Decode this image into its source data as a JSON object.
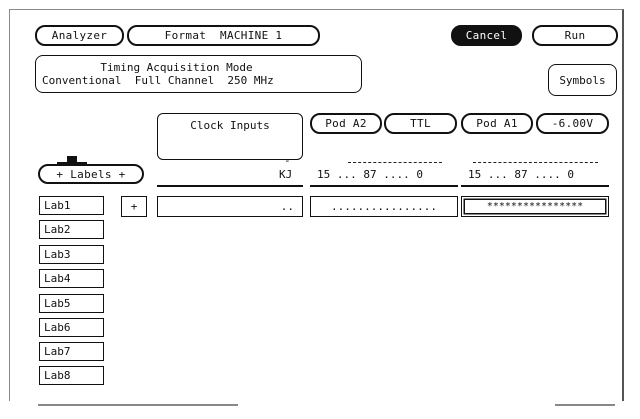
{
  "topbar": {
    "analyzer_label": "Analyzer",
    "format_label": "Format  MACHINE 1",
    "cancel_label": "Cancel",
    "run_label": "Run"
  },
  "mode": {
    "line1": "Timing Acquisition Mode",
    "line2": "Conventional  Full Channel  250 MHz"
  },
  "symbols_label": "Symbols",
  "clock_inputs_label": "Clock Inputs",
  "pods": [
    {
      "name": "Pod A2",
      "threshold": "TTL"
    },
    {
      "name": "Pod A1",
      "threshold": "-6.00V"
    }
  ],
  "labels_button": "+ Labels +",
  "column_headers": {
    "clock": "KJ",
    "pod_a2_bits": "15 ... 87 .... 0",
    "pod_a1_bits": "15 ... 87 .... 0"
  },
  "labels": [
    "Lab1",
    "Lab2",
    "Lab3",
    "Lab4",
    "Lab5",
    "Lab6",
    "Lab7",
    "Lab8"
  ],
  "lab1_row": {
    "polarity": "+",
    "clock_field": "..",
    "pod_a2_field": "................",
    "pod_a1_field": "****************"
  }
}
